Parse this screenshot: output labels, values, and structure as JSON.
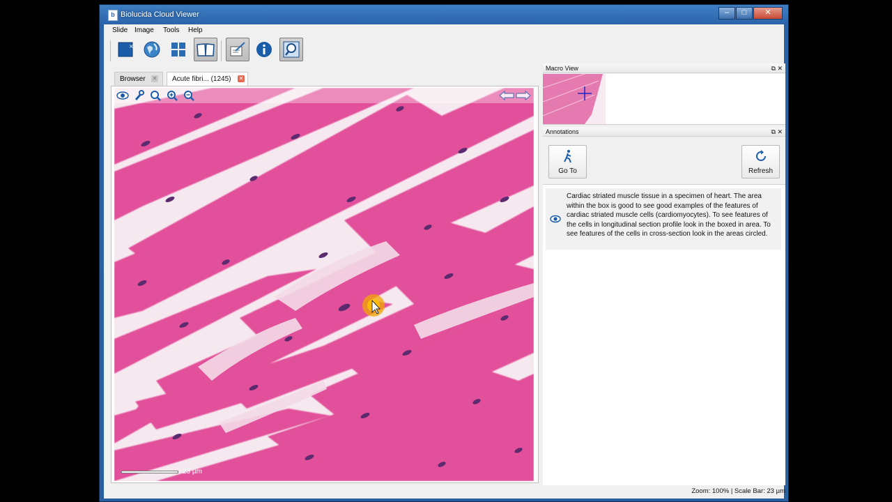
{
  "window": {
    "title": "Biolucida Cloud Viewer",
    "app_icon": "b",
    "controls": [
      "minimize-icon",
      "maximize-icon",
      "close-icon"
    ]
  },
  "menu": [
    "Slide",
    "Image",
    "Tools",
    "Help"
  ],
  "toolbar": [
    {
      "name": "close-slide-icon"
    },
    {
      "name": "globe-icon"
    },
    {
      "name": "grid-icon"
    },
    {
      "name": "book-icon"
    },
    {
      "name": "annotate-icon"
    },
    {
      "name": "info-icon"
    },
    {
      "name": "zoom-glass-icon"
    }
  ],
  "tabs": {
    "browser": "Browser",
    "slide": "Acute fibri... (1245)"
  },
  "viewer": {
    "tools": [
      "eye-icon",
      "wrench-icon",
      "magnifier-icon",
      "zoom-in-icon",
      "zoom-out-icon"
    ],
    "nav": [
      "arrow-left-icon",
      "arrow-right-icon"
    ],
    "scale_label": "23 µm"
  },
  "macro": {
    "title": "Macro View"
  },
  "annotations": {
    "title": "Annotations",
    "goto_label": "Go To",
    "refresh_label": "Refresh",
    "item_text": "Cardiac striated muscle tissue in a specimen of heart.  The area within the box is good to see good examples of the features of cardiac striated muscle cells (cardiomyocytes).  To see features of the cells in longitudinal section profile look in the boxed in area.  To see features of the cells in cross-section look in the areas circled."
  },
  "status": {
    "text": "Zoom: 100% | Scale Bar: 23 µm"
  },
  "colors": {
    "tissue_pink": "#e2509a",
    "nucleus": "#5c2a6e",
    "accent_blue": "#1b5da8",
    "tab_close": "#e5694f"
  }
}
